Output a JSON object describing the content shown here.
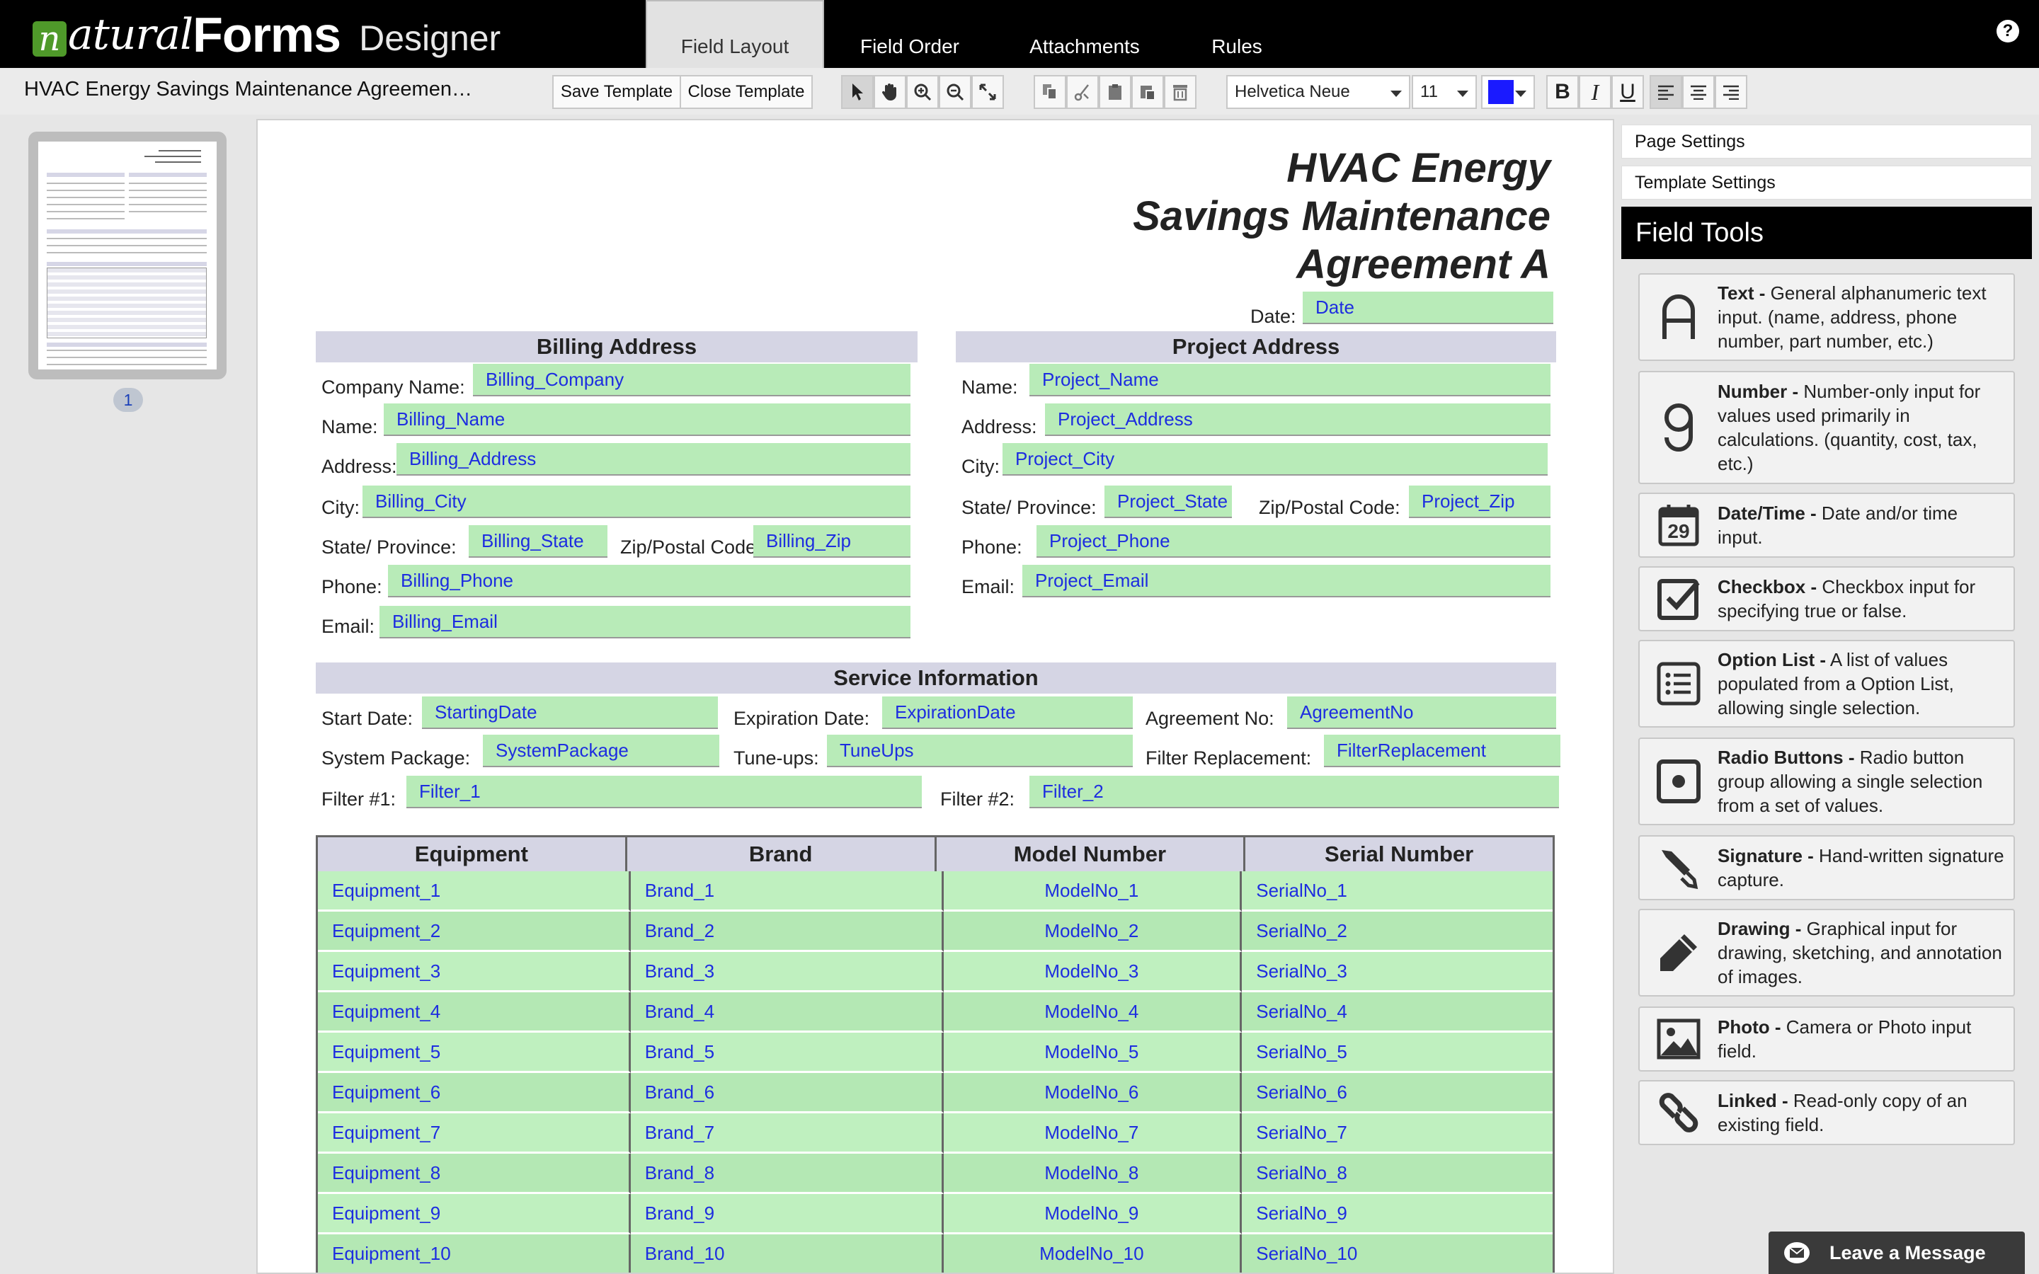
{
  "app": {
    "logo_n": "n",
    "logo_natural": "atural",
    "logo_forms": "Forms",
    "logo_designer": "Designer",
    "tabs": [
      {
        "label": "Field Layout",
        "active": true
      },
      {
        "label": "Field Order",
        "active": false
      },
      {
        "label": "Attachments",
        "active": false
      },
      {
        "label": "Rules",
        "active": false
      }
    ],
    "help": "?"
  },
  "toolbar": {
    "doc_title": "HVAC Energy Savings Maintenance Agreemen…",
    "save_template": "Save Template",
    "close_template": "Close Template",
    "font_family": "Helvetica Neue",
    "font_size": "11",
    "text_color": "#1a1aff",
    "icons": [
      "pointer-icon",
      "pan-hand-icon",
      "zoom-in-icon",
      "zoom-out-icon",
      "fit-page-icon",
      "copy-icon",
      "cut-icon",
      "paste-icon",
      "paste-special-icon",
      "delete-icon",
      "bold-icon",
      "italic-icon",
      "underline-icon",
      "align-left-icon",
      "align-center-icon",
      "align-right-icon"
    ]
  },
  "thumbnail": {
    "page_number": "1"
  },
  "form": {
    "title_lines": [
      "HVAC Energy",
      "Savings Maintenance",
      "Agreement A"
    ],
    "date_label": "Date:",
    "date_field": "Date",
    "billing": {
      "header": "Billing Address",
      "labels": {
        "company": "Company Name:",
        "name": "Name:",
        "address": "Address:",
        "city": "City:",
        "state": "State/ Province:",
        "zip": "Zip/Postal Code",
        "phone": "Phone:",
        "email": "Email:"
      },
      "fields": {
        "company": "Billing_Company",
        "name": "Billing_Name",
        "address": "Billing_Address",
        "city": "Billing_City",
        "state": "Billing_State",
        "zip": "Billing_Zip",
        "phone": "Billing_Phone",
        "email": "Billing_Email"
      }
    },
    "project": {
      "header": "Project Address",
      "labels": {
        "name": "Name:",
        "address": "Address:",
        "city": "City:",
        "state": "State/ Province:",
        "zip": "Zip/Postal Code:",
        "phone": "Phone:",
        "email": "Email:"
      },
      "fields": {
        "name": "Project_Name",
        "address": "Project_Address",
        "city": "Project_City",
        "state": "Project_State",
        "zip": "Project_Zip",
        "phone": "Project_Phone",
        "email": "Project_Email"
      }
    },
    "service": {
      "header": "Service Information",
      "labels": {
        "start": "Start Date:",
        "expiration": "Expiration Date:",
        "agreement": "Agreement No:",
        "package": "System Package:",
        "tuneups": "Tune-ups:",
        "filter_repl": "Filter Replacement:",
        "filter1": "Filter #1:",
        "filter2": "Filter #2:"
      },
      "fields": {
        "start": "StartingDate",
        "expiration": "ExpirationDate",
        "agreement": "AgreementNo",
        "package": "SystemPackage",
        "tuneups": "TuneUps",
        "filter_repl": "FilterReplacement",
        "filter1": "Filter_1",
        "filter2": "Filter_2"
      }
    },
    "equipment": {
      "headers": [
        "Equipment",
        "Brand",
        "Model Number",
        "Serial Number"
      ],
      "rows": [
        [
          "Equipment_1",
          "Brand_1",
          "ModelNo_1",
          "SerialNo_1"
        ],
        [
          "Equipment_2",
          "Brand_2",
          "ModelNo_2",
          "SerialNo_2"
        ],
        [
          "Equipment_3",
          "Brand_3",
          "ModelNo_3",
          "SerialNo_3"
        ],
        [
          "Equipment_4",
          "Brand_4",
          "ModelNo_4",
          "SerialNo_4"
        ],
        [
          "Equipment_5",
          "Brand_5",
          "ModelNo_5",
          "SerialNo_5"
        ],
        [
          "Equipment_6",
          "Brand_6",
          "ModelNo_6",
          "SerialNo_6"
        ],
        [
          "Equipment_7",
          "Brand_7",
          "ModelNo_7",
          "SerialNo_7"
        ],
        [
          "Equipment_8",
          "Brand_8",
          "ModelNo_8",
          "SerialNo_8"
        ],
        [
          "Equipment_9",
          "Brand_9",
          "ModelNo_9",
          "SerialNo_9"
        ],
        [
          "Equipment_10",
          "Brand_10",
          "ModelNo_10",
          "SerialNo_10"
        ]
      ]
    }
  },
  "right_panel": {
    "page_settings": "Page Settings",
    "template_settings": "Template Settings",
    "field_tools_title": "Field Tools",
    "tools": [
      {
        "icon": "letter-a-icon",
        "name": "Text -",
        "desc": " General alphanumeric text input. (name, address, phone number, part number, etc.)"
      },
      {
        "icon": "digit-9-icon",
        "name": "Number -",
        "desc": " Number-only input for values used primarily in calculations. (quantity, cost, tax, etc.)"
      },
      {
        "icon": "calendar-icon",
        "name": "Date/Time -",
        "desc": " Date and/or time input."
      },
      {
        "icon": "checkbox-icon",
        "name": "Checkbox -",
        "desc": " Checkbox input for specifying true or false."
      },
      {
        "icon": "option-list-icon",
        "name": "Option List -",
        "desc": " A list of values populated from a Option List, allowing single selection."
      },
      {
        "icon": "radio-button-icon",
        "name": "Radio Buttons -",
        "desc": " Radio button group allowing a single selection from a set of values."
      },
      {
        "icon": "pen-icon",
        "name": "Signature -",
        "desc": " Hand-written signature capture."
      },
      {
        "icon": "pencil-icon",
        "name": "Drawing -",
        "desc": " Graphical input for drawing, sketching, and annotation of images."
      },
      {
        "icon": "photo-icon",
        "name": "Photo -",
        "desc": " Camera or Photo input field."
      },
      {
        "icon": "link-icon",
        "name": "Linked -",
        "desc": " Read-only copy of an existing field."
      }
    ],
    "calendar_day": "29"
  },
  "chat": {
    "leave_message": "Leave a Message"
  },
  "colors": {
    "field_green": "#b8ebb8",
    "field_text": "#1d2de0",
    "header_lavender": "#d5d5e4",
    "logo_green": "#4f9a2a"
  }
}
